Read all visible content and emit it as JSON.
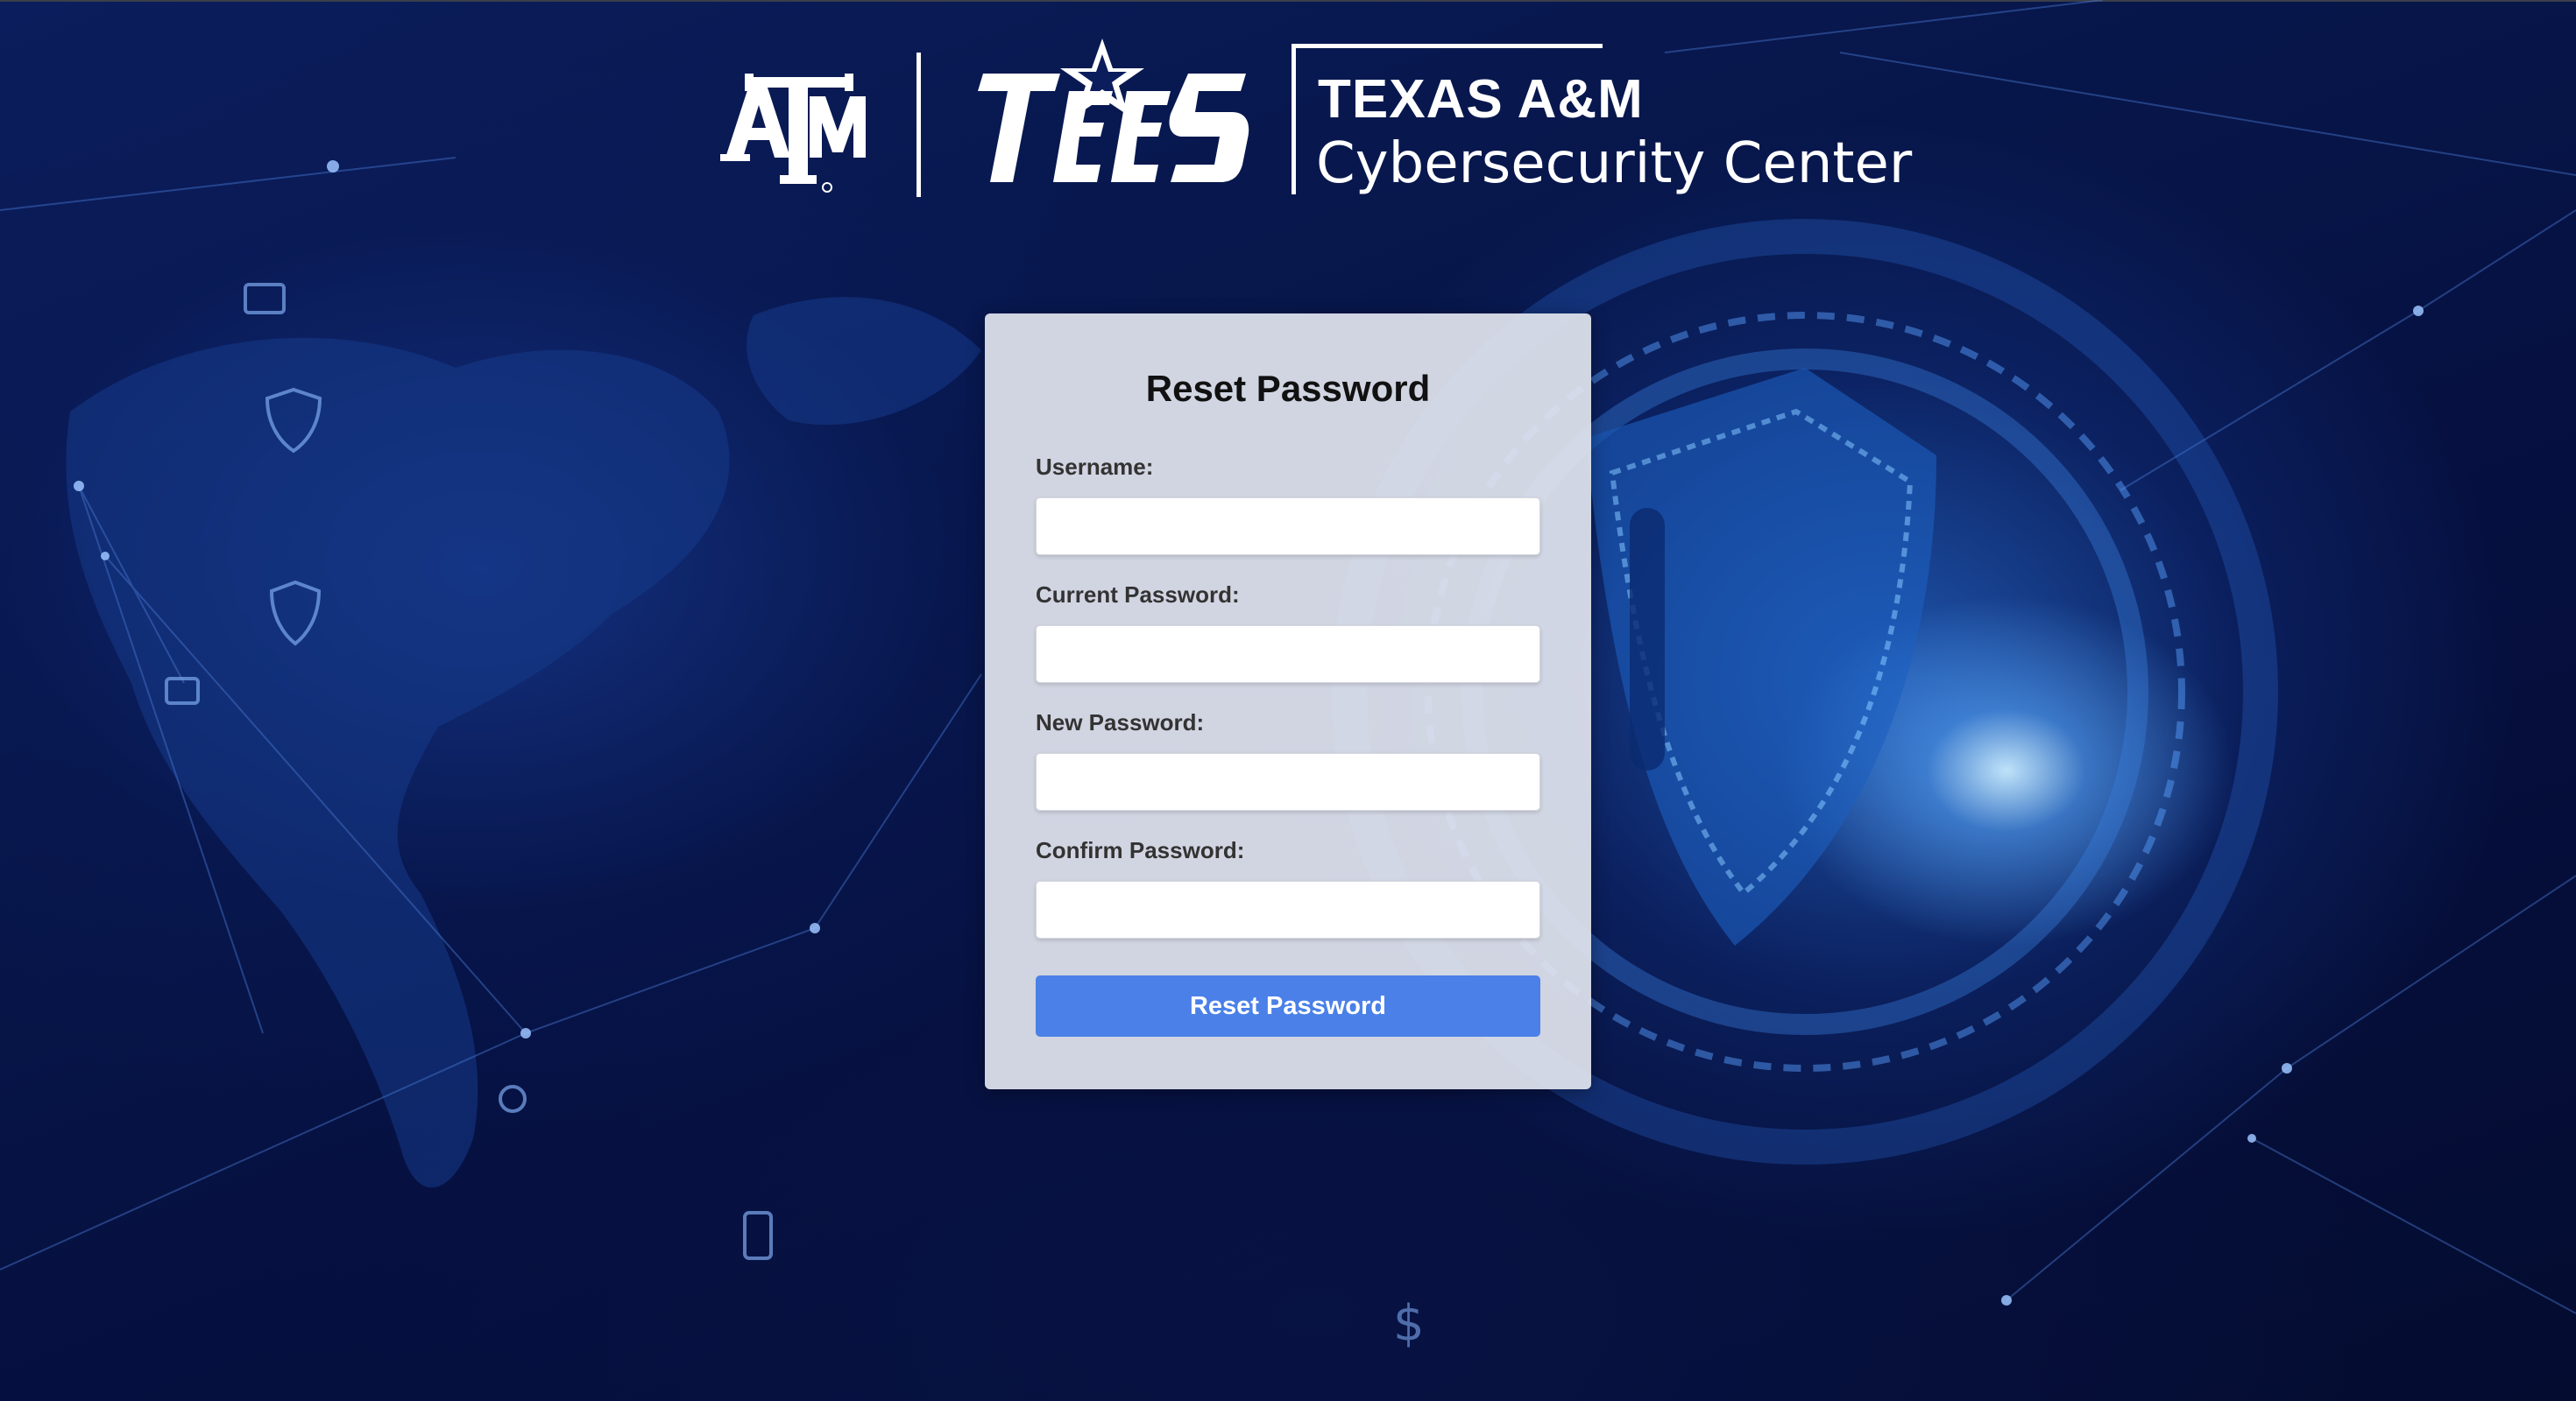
{
  "header": {
    "atm_logo_text": "ATM",
    "tees_logo_text": "TEES",
    "org_line1": "TEXAS A&M",
    "org_line2": "Cybersecurity Center"
  },
  "form": {
    "title": "Reset Password",
    "fields": [
      {
        "label": "Username:",
        "value": "",
        "type": "text"
      },
      {
        "label": "Current Password:",
        "value": "",
        "type": "password"
      },
      {
        "label": "New Password:",
        "value": "",
        "type": "password"
      },
      {
        "label": "Confirm Password:",
        "value": "",
        "type": "password"
      }
    ],
    "submit_label": "Reset Password"
  },
  "colors": {
    "background": "#07164a",
    "card": "#e1e4ee",
    "button": "#4a80e8",
    "text": "#111111"
  },
  "icons": [
    "shield-icon",
    "laptop-icon",
    "user-icon",
    "phone-icon",
    "dollar-icon",
    "padlock-shield-icon"
  ]
}
